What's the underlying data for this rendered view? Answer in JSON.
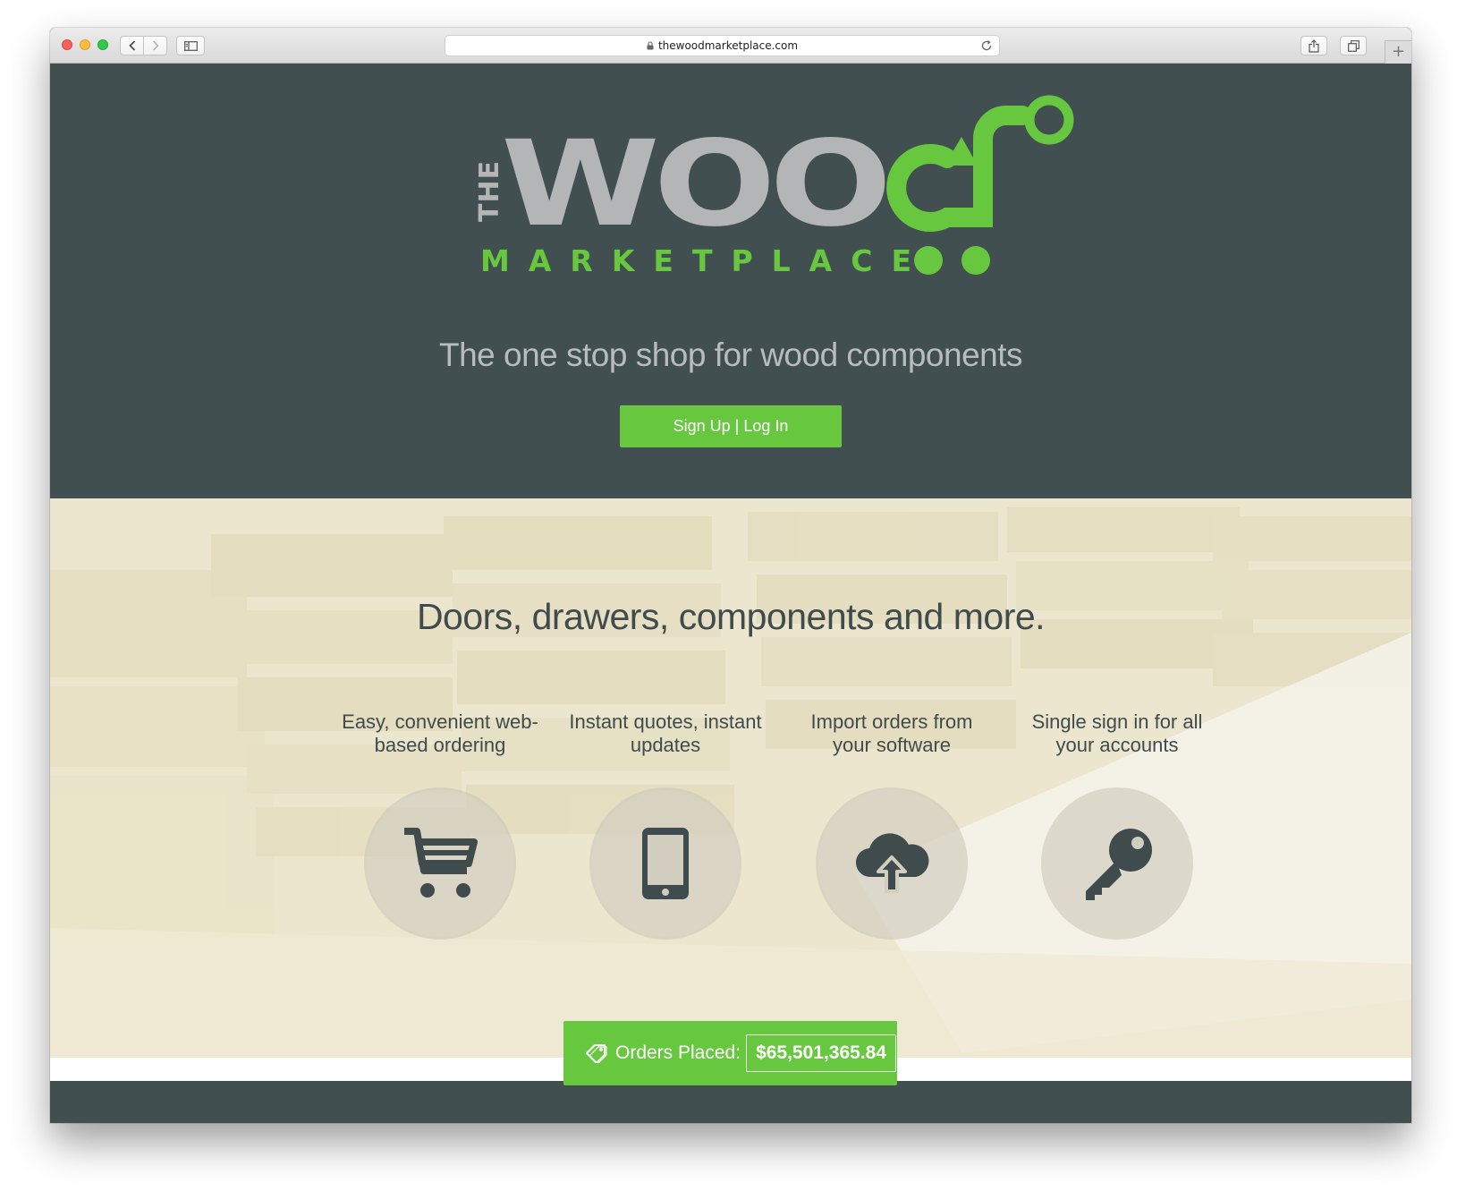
{
  "browser": {
    "url": "thewoodmarketplace.com",
    "new_tab_label": "+"
  },
  "logo": {
    "word_the": "THE",
    "word_main": "WOOD",
    "word_sub": "MARKETPLACE"
  },
  "hero": {
    "tagline": "The one stop shop for wood components",
    "cta_label": "Sign Up | Log In"
  },
  "features": {
    "title": "Doors, drawers, components and more.",
    "items": [
      {
        "line1": "Easy, convenient web-",
        "line2": "based ordering",
        "icon": "cart-icon"
      },
      {
        "line1": "Instant quotes, instant",
        "line2": "updates",
        "icon": "phone-icon"
      },
      {
        "line1": "Import orders from",
        "line2": "your software",
        "icon": "cloud-upload-icon"
      },
      {
        "line1": "Single sign in for all",
        "line2": "your accounts",
        "icon": "key-icon"
      }
    ]
  },
  "orders": {
    "label": "Orders Placed:",
    "value": "$65,501,365.84",
    "icon": "tag-icon"
  },
  "colors": {
    "brand_green": "#67c83f",
    "dark_slate": "#414f50",
    "logo_gray": "#b3b5b7"
  }
}
